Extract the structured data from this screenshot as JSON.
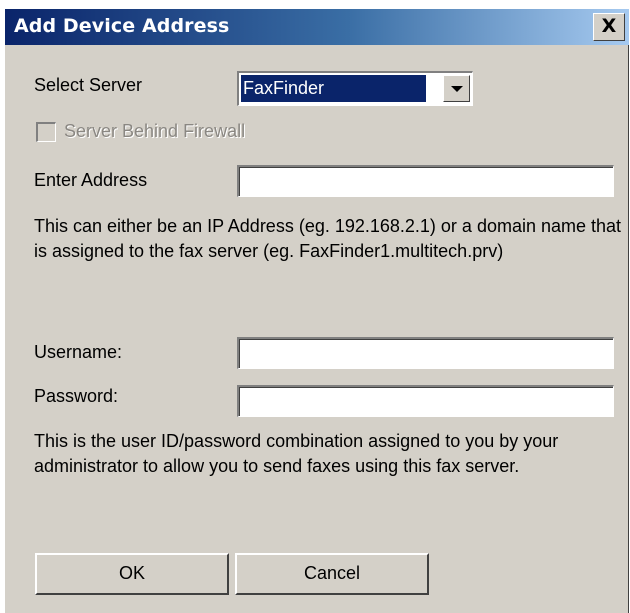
{
  "window": {
    "title": "Add Device Address",
    "close_glyph": "X"
  },
  "server": {
    "label": "Select Server",
    "selected": "FaxFinder"
  },
  "firewall": {
    "label": "Server Behind Firewall",
    "checked": false,
    "enabled": false
  },
  "address": {
    "label": "Enter Address",
    "value": "",
    "help": "This can either be an IP Address (eg. 192.168.2.1) or a domain name that is assigned to the fax server (eg. FaxFinder1.multitech.prv)"
  },
  "credentials": {
    "username_label": "Username:",
    "username_value": "",
    "password_label": "Password:",
    "password_value": "",
    "help": "This is the user ID/password combination assigned to you by your administrator to allow you to send faxes using this fax server."
  },
  "buttons": {
    "ok": "OK",
    "cancel": "Cancel"
  },
  "colors": {
    "titlebar_start": "#0a246a",
    "titlebar_end": "#a6caf0",
    "dialog_bg": "#d4d0c8",
    "selection": "#0a246a"
  }
}
